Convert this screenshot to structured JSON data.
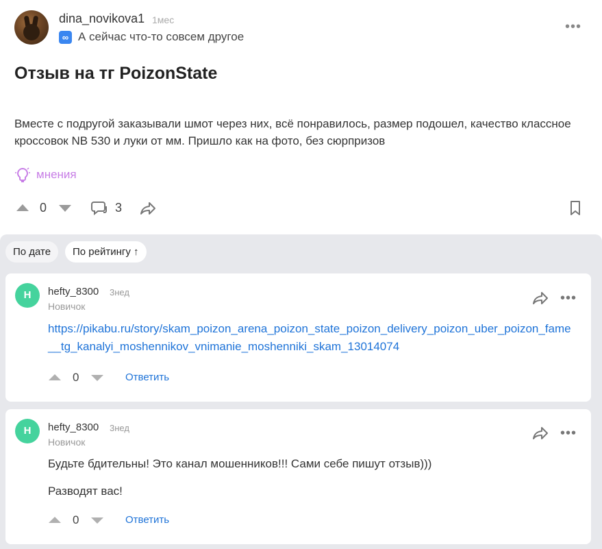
{
  "post": {
    "author": "dina_novikova1",
    "time": "1мес",
    "status_icon": "infinity-icon",
    "status_text": "А сейчас что-то совсем другое",
    "title": "Отзыв на тг PoizonState",
    "body": "Вместе с подругой заказывали шмот через них, всё понравилось, размер подошел, качество классное кроссовок NB 530 и луки от мм. Пришло как на фото, без сюрпризов",
    "tag": "мнения",
    "score": "0",
    "comments_count": "3",
    "colors": {
      "tag": "#c77de6",
      "badge": "#3a86f0"
    }
  },
  "sort": {
    "by_date": "По дате",
    "by_rating": "По рейтингу ↑"
  },
  "comments": [
    {
      "avatar_letter": "H",
      "author": "hefty_8300",
      "time": "3нед",
      "rank": "Новичок",
      "link": "https://pikabu.ru/story/skam_poizon_arena_poizon_state_poizon_delivery_poizon_uber_poizon_fame__tg_kanalyi_moshennikov_vnimanie_moshenniki_skam_13014074",
      "score": "0",
      "reply": "Ответить"
    },
    {
      "avatar_letter": "H",
      "author": "hefty_8300",
      "time": "3нед",
      "rank": "Новичок",
      "text1": "Будьте бдительны! Это канал мошенников!!! Сами себе пишут отзыв)))",
      "text2": "Разводят вас!",
      "score": "0",
      "reply": "Ответить"
    }
  ],
  "colors": {
    "avatar": "#45d39d",
    "link": "#1e73d8",
    "comments_bg": "#e7e8ec"
  }
}
